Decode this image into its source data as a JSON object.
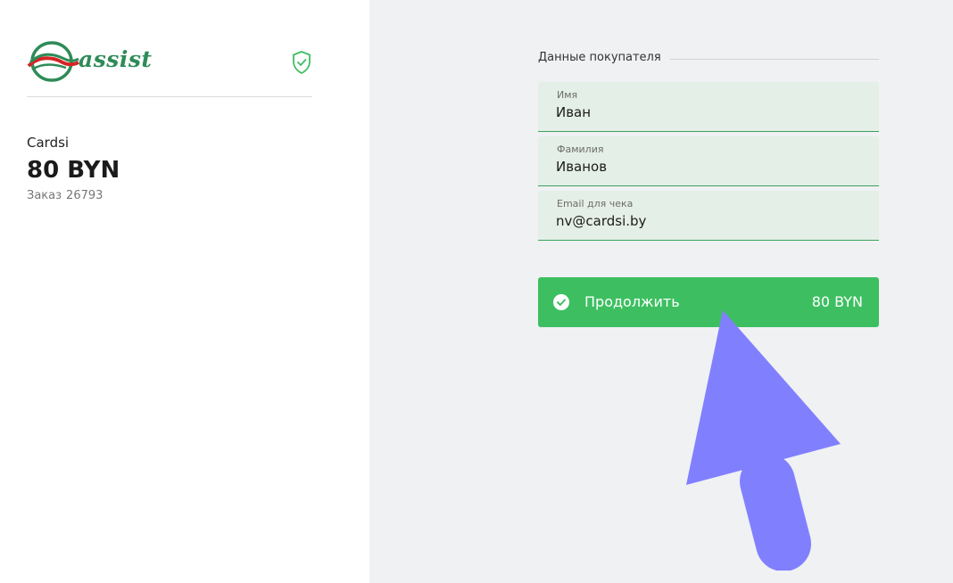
{
  "brand": {
    "logo_text": "assist",
    "logo_icon": "assist-logo-icon",
    "secure_icon": "shield-check-icon",
    "accent_color": "#3dbf61"
  },
  "order": {
    "merchant": "Cardsi",
    "amount": "80 BYN",
    "order_label": "Заказ",
    "order_number": "26793"
  },
  "customer": {
    "section_title": "Данные покупателя",
    "fields": [
      {
        "label": "Имя",
        "value": "Иван"
      },
      {
        "label": "Фамилия",
        "value": "Иванов"
      },
      {
        "label": "Email для чека",
        "value": "nv@cardsi.by"
      }
    ]
  },
  "continue_button": {
    "label": "Продолжить",
    "amount": "80 BYN",
    "icon": "check-circle-icon"
  },
  "overlay": {
    "pointer_icon": "pointer-arrow-icon",
    "pointer_color": "#8080ff"
  }
}
